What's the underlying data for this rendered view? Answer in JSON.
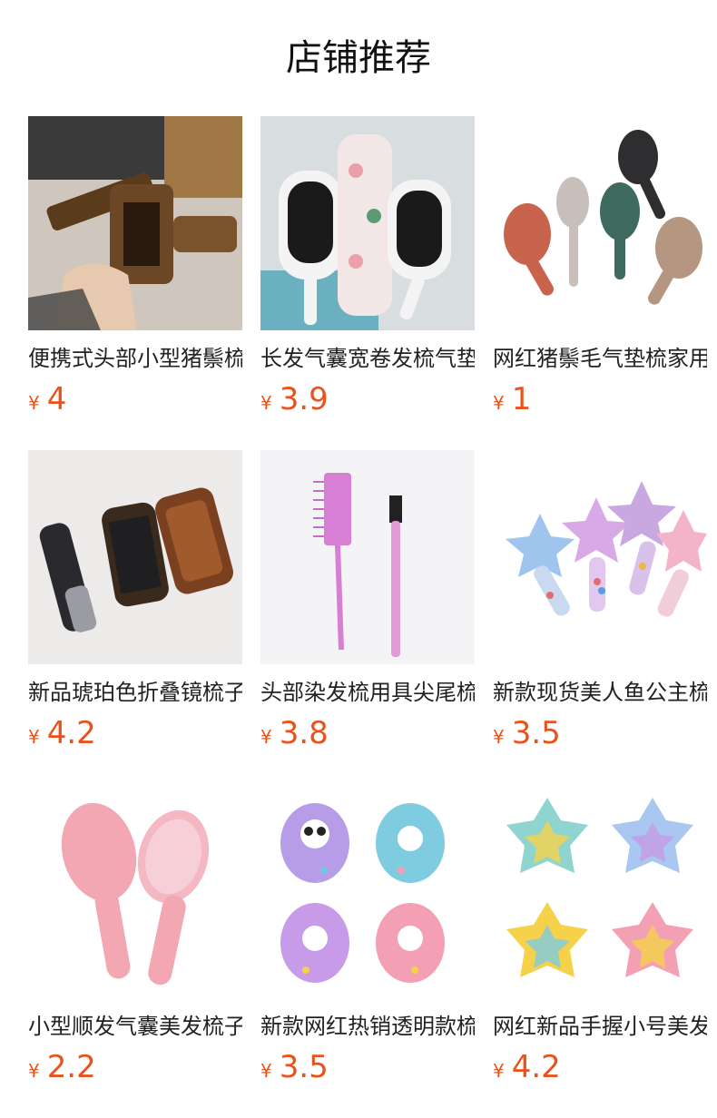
{
  "header": {
    "title": "店铺推荐"
  },
  "products": [
    {
      "name": "便携式头部小型猪鬃梳",
      "currency": "¥",
      "price": "4"
    },
    {
      "name": "长发气囊宽卷发梳气垫",
      "currency": "¥",
      "price": "3.9"
    },
    {
      "name": "网红猪鬃毛气垫梳家用",
      "currency": "¥",
      "price": "1"
    },
    {
      "name": "新品琥珀色折叠镜梳子",
      "currency": "¥",
      "price": "4.2"
    },
    {
      "name": "头部染发梳用具尖尾梳",
      "currency": "¥",
      "price": "3.8"
    },
    {
      "name": "新款现货美人鱼公主梳",
      "currency": "¥",
      "price": "3.5"
    },
    {
      "name": "小型顺发气囊美发梳子",
      "currency": "¥",
      "price": "2.2"
    },
    {
      "name": "新款网红热销透明款梳",
      "currency": "¥",
      "price": "3.5"
    },
    {
      "name": "网红新品手握小号美发",
      "currency": "¥",
      "price": "4.2"
    }
  ]
}
